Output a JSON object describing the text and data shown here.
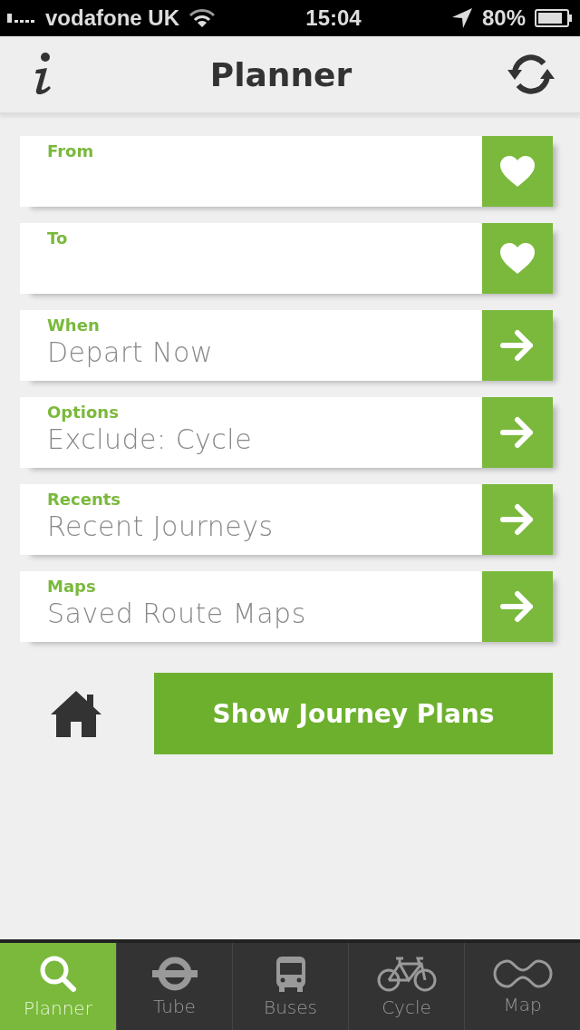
{
  "status_bar": {
    "carrier": "vodafone UK",
    "time": "15:04",
    "battery": "80%"
  },
  "header": {
    "title": "Planner"
  },
  "rows": [
    {
      "kind": "field",
      "label": "From"
    },
    {
      "kind": "field",
      "label": "To"
    },
    {
      "kind": "link",
      "label": "When",
      "value": "Depart Now"
    },
    {
      "kind": "link",
      "label": "Options",
      "value": "Exclude: Cycle"
    },
    {
      "kind": "link",
      "label": "Recents",
      "value": "Recent Journeys"
    },
    {
      "kind": "link",
      "label": "Maps",
      "value": "Saved Route Maps"
    }
  ],
  "action_button": "Show Journey Plans",
  "tabs": [
    {
      "kind": "search",
      "label": "Planner",
      "selected": true
    },
    {
      "kind": "tube",
      "label": "Tube",
      "selected": false
    },
    {
      "kind": "bus",
      "label": "Buses",
      "selected": false
    },
    {
      "kind": "cycle",
      "label": "Cycle",
      "selected": false
    },
    {
      "kind": "map",
      "label": "Map",
      "selected": false
    }
  ]
}
